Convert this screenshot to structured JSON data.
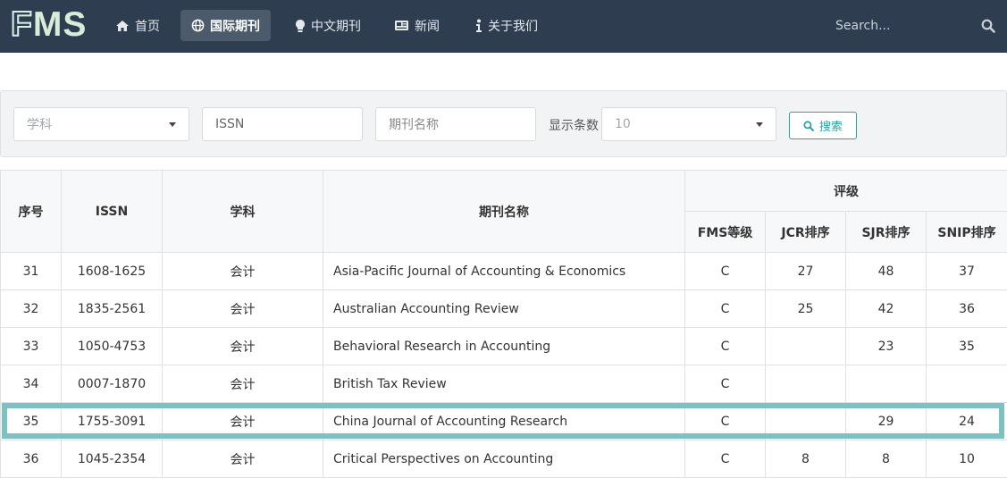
{
  "brand": {
    "logo_first": "F",
    "logo_rest": "MS"
  },
  "nav": {
    "items": [
      {
        "label": "首页",
        "icon": "home-icon"
      },
      {
        "label": "国际期刊",
        "icon": "globe-icon",
        "active": true
      },
      {
        "label": "中文期刊",
        "icon": "lightbulb-icon"
      },
      {
        "label": "新闻",
        "icon": "newspaper-icon"
      },
      {
        "label": "关于我们",
        "icon": "info-icon"
      }
    ],
    "search_placeholder": "Search..."
  },
  "filter": {
    "subject_placeholder": "学科",
    "issn_placeholder": "ISSN",
    "name_placeholder": "期刊名称",
    "show_label": "显示条数",
    "page_size": "10",
    "search_button": "搜索"
  },
  "table": {
    "headers": {
      "index": "序号",
      "issn": "ISSN",
      "subject": "学科",
      "name": "期刊名称",
      "rating": "评级",
      "fms": "FMS等级",
      "jcr": "JCR排序",
      "sjr": "SJR排序",
      "snip": "SNIP排序"
    },
    "rows": [
      {
        "index": "31",
        "issn": "1608-1625",
        "subject": "会计",
        "name": "Asia-Pacific Journal of Accounting & Economics",
        "fms": "C",
        "jcr": "27",
        "sjr": "48",
        "snip": "37"
      },
      {
        "index": "32",
        "issn": "1835-2561",
        "subject": "会计",
        "name": "Australian Accounting Review",
        "fms": "C",
        "jcr": "25",
        "sjr": "42",
        "snip": "36"
      },
      {
        "index": "33",
        "issn": "1050-4753",
        "subject": "会计",
        "name": "Behavioral Research in Accounting",
        "fms": "C",
        "jcr": "",
        "sjr": "23",
        "snip": "35"
      },
      {
        "index": "34",
        "issn": "0007-1870",
        "subject": "会计",
        "name": "British Tax Review",
        "fms": "C",
        "jcr": "",
        "sjr": "",
        "snip": ""
      },
      {
        "index": "35",
        "issn": "1755-3091",
        "subject": "会计",
        "name": "China Journal of Accounting Research",
        "fms": "C",
        "jcr": "",
        "sjr": "29",
        "snip": "24"
      },
      {
        "index": "36",
        "issn": "1045-2354",
        "subject": "会计",
        "name": "Critical Perspectives on Accounting",
        "fms": "C",
        "jcr": "8",
        "sjr": "8",
        "snip": "10"
      }
    ]
  },
  "colors": {
    "navbar": "#2e3e50",
    "accent": "#2aa6a0",
    "highlight": "#7dc2c0"
  }
}
